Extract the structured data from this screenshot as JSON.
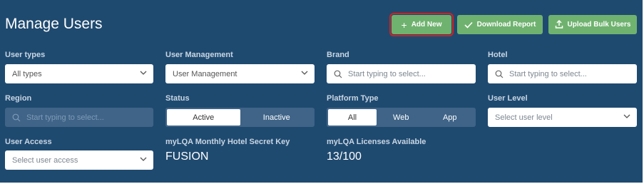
{
  "header": {
    "title": "Manage Users",
    "buttons": {
      "add_new": "Add New",
      "download_report": "Download Report",
      "upload_bulk_users": "Upload Bulk Users"
    }
  },
  "filters": {
    "user_types": {
      "label": "User types",
      "value": "All types"
    },
    "user_management": {
      "label": "User Management",
      "value": "User Management"
    },
    "brand": {
      "label": "Brand",
      "placeholder": "Start typing to select..."
    },
    "hotel": {
      "label": "Hotel",
      "placeholder": "Start typing to select..."
    },
    "region": {
      "label": "Region",
      "placeholder": "Start typing to select..."
    },
    "status": {
      "label": "Status",
      "options": [
        "Active",
        "Inactive"
      ],
      "selected": "Active"
    },
    "platform_type": {
      "label": "Platform Type",
      "options": [
        "All",
        "Web",
        "App"
      ],
      "selected": "All"
    },
    "user_level": {
      "label": "User Level",
      "placeholder": "Select user level"
    },
    "user_access": {
      "label": "User Access",
      "placeholder": "Select user access"
    }
  },
  "info": {
    "secret_key": {
      "label": "myLQA Monthly Hotel Secret Key",
      "value": "FUSION"
    },
    "licenses": {
      "label": "myLQA Licenses Available",
      "value": "13/100"
    }
  },
  "colors": {
    "panel_bg": "#1f4a70",
    "button_green": "#6fb26f",
    "highlight_red": "#d32020",
    "segment_bg": "#3f6488"
  },
  "icons": {
    "add": "plus-icon",
    "download": "check-icon",
    "upload": "upload-icon",
    "dropdown": "chevron-down-icon",
    "search": "search-icon"
  }
}
